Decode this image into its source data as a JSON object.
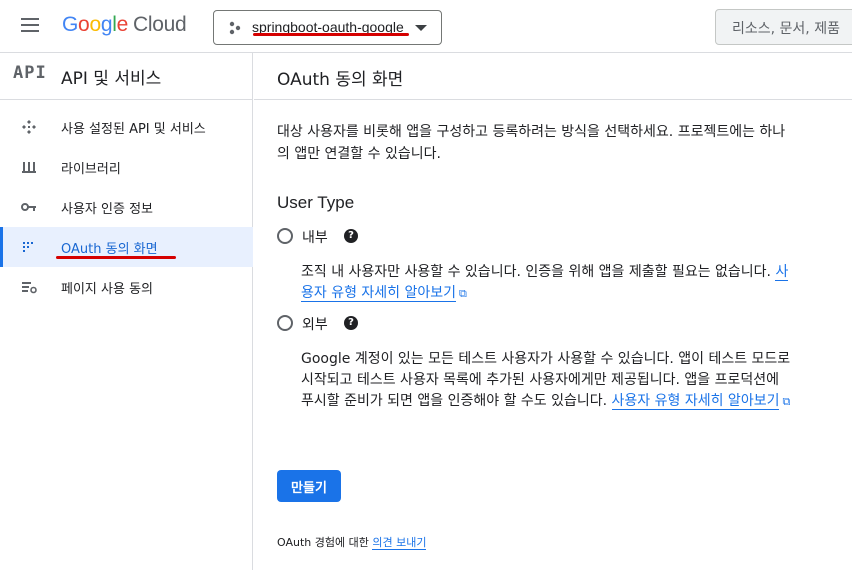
{
  "header": {
    "logo_google": "Google",
    "logo_cloud": "Cloud",
    "project_name": "springboot-oauth-google",
    "search_placeholder": "리소스, 문서, 제품"
  },
  "sidebar": {
    "badge": "API",
    "title": "API 및 서비스",
    "items": [
      {
        "label": "사용 설정된 API 및 서비스",
        "icon": "api-diamond-icon"
      },
      {
        "label": "라이브러리",
        "icon": "library-icon"
      },
      {
        "label": "사용자 인증 정보",
        "icon": "key-icon"
      },
      {
        "label": "OAuth 동의 화면",
        "icon": "consent-grid-icon",
        "active": true
      },
      {
        "label": "페이지 사용 동의",
        "icon": "settings-list-icon"
      }
    ]
  },
  "main": {
    "title": "OAuth 동의 화면",
    "description": "대상 사용자를 비롯해 앱을 구성하고 등록하려는 방식을 선택하세요. 프로젝트에는 하나의 앱만 연결할 수 있습니다.",
    "user_type_heading": "User Type",
    "options": [
      {
        "label": "내부",
        "description": "조직 내 사용자만 사용할 수 있습니다. 인증을 위해 앱을 제출할 필요는 없습니다.",
        "link": "사용자 유형 자세히 알아보기"
      },
      {
        "label": "외부",
        "description": "Google 계정이 있는 모든 테스트 사용자가 사용할 수 있습니다. 앱이 테스트 모드로 시작되고 테스트 사용자 목록에 추가된 사용자에게만 제공됩니다. 앱을 프로덕션에 푸시할 준비가 되면 앱을 인증해야 할 수도 있습니다.",
        "link": "사용자 유형 자세히 알아보기"
      }
    ],
    "create_button": "만들기",
    "footer_text": "OAuth 경험에 대한",
    "footer_link": "의견 보내기"
  },
  "colors": {
    "accent": "#1a73e8",
    "annotation": "#d50000"
  }
}
